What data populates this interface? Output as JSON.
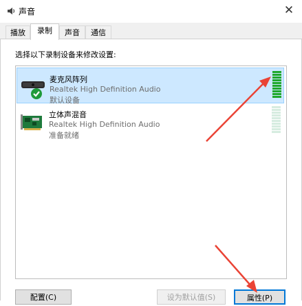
{
  "window": {
    "title": "声音"
  },
  "tabs": [
    {
      "label": "播放"
    },
    {
      "label": "录制"
    },
    {
      "label": "声音"
    },
    {
      "label": "通信"
    }
  ],
  "active_tab": "录制",
  "instruction": "选择以下录制设备来修改设置:",
  "devices": [
    {
      "name": "麦克风阵列",
      "description": "Realtek High Definition Audio",
      "status": "默认设备",
      "selected": true,
      "is_default": true,
      "icon": "microphone-array-icon",
      "level_bars_lit": 10,
      "level_bars_total": 10
    },
    {
      "name": "立体声混音",
      "description": "Realtek High Definition Audio",
      "status": "准备就绪",
      "selected": false,
      "is_default": false,
      "icon": "sound-card-icon",
      "level_bars_lit": 0,
      "level_bars_total": 10
    }
  ],
  "buttons": {
    "configure": "配置(C)",
    "set_default": "设为默认值(S)",
    "properties": "属性(P)"
  },
  "colors": {
    "selection": "#cde8ff",
    "meter_on": "#1fa82c",
    "meter_off": "#d6ece0",
    "annotation": "#ea4335"
  }
}
